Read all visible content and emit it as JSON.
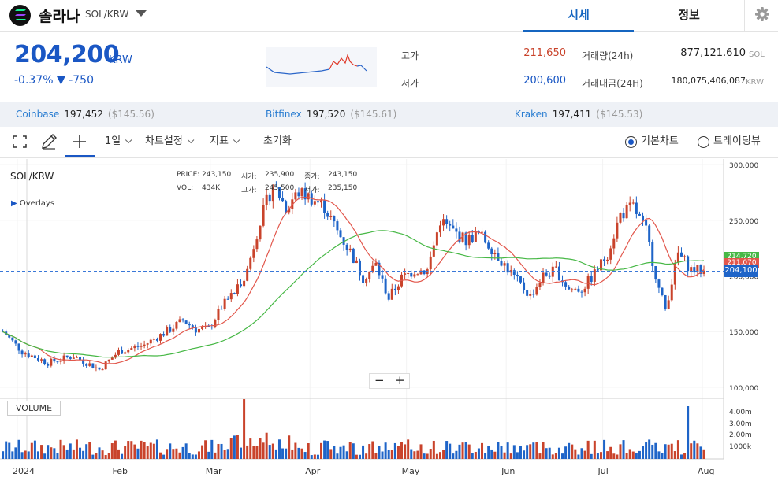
{
  "header": {
    "coin_name": "솔라나",
    "pair": "SOL/KRW",
    "tabs": [
      {
        "label": "시세",
        "active": true
      },
      {
        "label": "정보",
        "active": false
      }
    ]
  },
  "price": {
    "current": "204,200",
    "unit": "KRW",
    "change_pct": "-0.37%",
    "change_amt": "▼ -750"
  },
  "stats": {
    "high_label": "고가",
    "high_value": "211,650",
    "low_label": "저가",
    "low_value": "200,600",
    "volume_label": "거래량(24h)",
    "volume_value": "877,121.610",
    "volume_unit": "SOL",
    "amount_label": "거래대금(24H)",
    "amount_value": "180,075,406,087",
    "amount_unit": "KRW"
  },
  "exchanges": [
    {
      "name": "Coinbase",
      "price": "197,452",
      "usd": "($145.56)"
    },
    {
      "name": "Bitfinex",
      "price": "197,520",
      "usd": "($145.61)"
    },
    {
      "name": "Kraken",
      "price": "197,411",
      "usd": "($145.53)"
    }
  ],
  "toolbar": {
    "interval": "1일",
    "chart_settings": "차트설정",
    "indicators": "지표",
    "reset": "초기화",
    "basic_chart": "기본차트",
    "tradingview": "트레이딩뷰"
  },
  "chart_info": {
    "symbol": "SOL/KRW",
    "overlays": "Overlays",
    "price_label": "PRICE:",
    "price_value": "243,150",
    "vol_label": "VOL:",
    "vol_value": "434K",
    "open_label": "시가:",
    "open_value": "235,900",
    "close_label": "종가:",
    "close_value": "243,150",
    "high_label": "고가:",
    "high_value": "245,500",
    "low_label": "저가:",
    "low_value": "235,150",
    "volume_title": "VOLUME",
    "last_price": "204,100",
    "ma_tag_green": "214,720",
    "ma_tag_red": "211,070"
  },
  "colors": {
    "up": "#c9432b",
    "down": "#1e64c8",
    "ma_short": "#e2574c",
    "ma_long": "#47b846",
    "accent": "#1565c0"
  },
  "chart_data": {
    "type": "candlestick",
    "x_labels": [
      "2024",
      "Feb",
      "Mar",
      "Apr",
      "May",
      "Jun",
      "Jul",
      "Aug"
    ],
    "y_ticks": [
      "300,000",
      "250,000",
      "200,000",
      "150,000",
      "100,000"
    ],
    "vol_ticks": [
      "4.00m",
      "3.00m",
      "2.00m",
      "1000k"
    ],
    "ylim": [
      90000,
      305000
    ],
    "trend": [
      [
        0,
        150000
      ],
      [
        6,
        132000
      ],
      [
        14,
        122000
      ],
      [
        22,
        128000
      ],
      [
        30,
        116000
      ],
      [
        36,
        132000
      ],
      [
        44,
        138000
      ],
      [
        52,
        152000
      ],
      [
        56,
        160000
      ],
      [
        60,
        152000
      ],
      [
        64,
        152000
      ],
      [
        68,
        172000
      ],
      [
        72,
        185000
      ],
      [
        76,
        205000
      ],
      [
        80,
        250000
      ],
      [
        84,
        282000
      ],
      [
        88,
        262000
      ],
      [
        92,
        275000
      ],
      [
        96,
        270000
      ],
      [
        100,
        262000
      ],
      [
        104,
        240000
      ],
      [
        108,
        222000
      ],
      [
        112,
        198000
      ],
      [
        116,
        210000
      ],
      [
        120,
        180000
      ],
      [
        124,
        198000
      ],
      [
        128,
        205000
      ],
      [
        132,
        205000
      ],
      [
        136,
        250000
      ],
      [
        140,
        240000
      ],
      [
        144,
        232000
      ],
      [
        148,
        238000
      ],
      [
        152,
        225000
      ],
      [
        156,
        210000
      ],
      [
        160,
        195000
      ],
      [
        164,
        182000
      ],
      [
        168,
        200000
      ],
      [
        172,
        205000
      ],
      [
        176,
        188000
      ],
      [
        180,
        188000
      ],
      [
        184,
        202000
      ],
      [
        188,
        220000
      ],
      [
        192,
        255000
      ],
      [
        196,
        262000
      ],
      [
        200,
        240000
      ],
      [
        204,
        188000
      ],
      [
        206,
        170000
      ],
      [
        210,
        220000
      ],
      [
        214,
        206000
      ],
      [
        218,
        204200
      ]
    ],
    "volume_highlights": [
      [
        75,
        4.9
      ],
      [
        213,
        5.4
      ]
    ]
  }
}
